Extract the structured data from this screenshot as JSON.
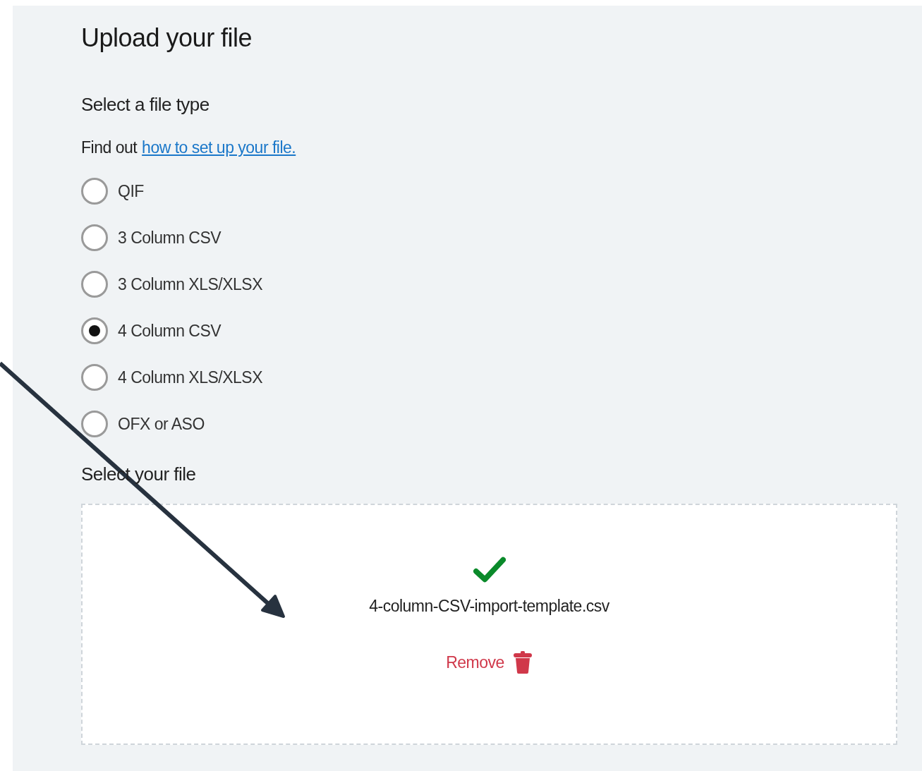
{
  "title": "Upload your file",
  "file_type": {
    "heading": "Select a file type",
    "hint": "Find out",
    "hint_link": "how to set up your file.",
    "options": [
      {
        "label": "QIF",
        "selected": false
      },
      {
        "label": "3 Column CSV",
        "selected": false
      },
      {
        "label": "3 Column XLS/XLSX",
        "selected": false
      },
      {
        "label": "4 Column CSV",
        "selected": true
      },
      {
        "label": "4 Column XLS/XLSX",
        "selected": false
      },
      {
        "label": "OFX or ASO",
        "selected": false
      }
    ]
  },
  "file": {
    "heading": "Select your file",
    "uploaded": true,
    "file_name": "4-column-CSV-import-template.csv",
    "remove_label": "Remove"
  }
}
